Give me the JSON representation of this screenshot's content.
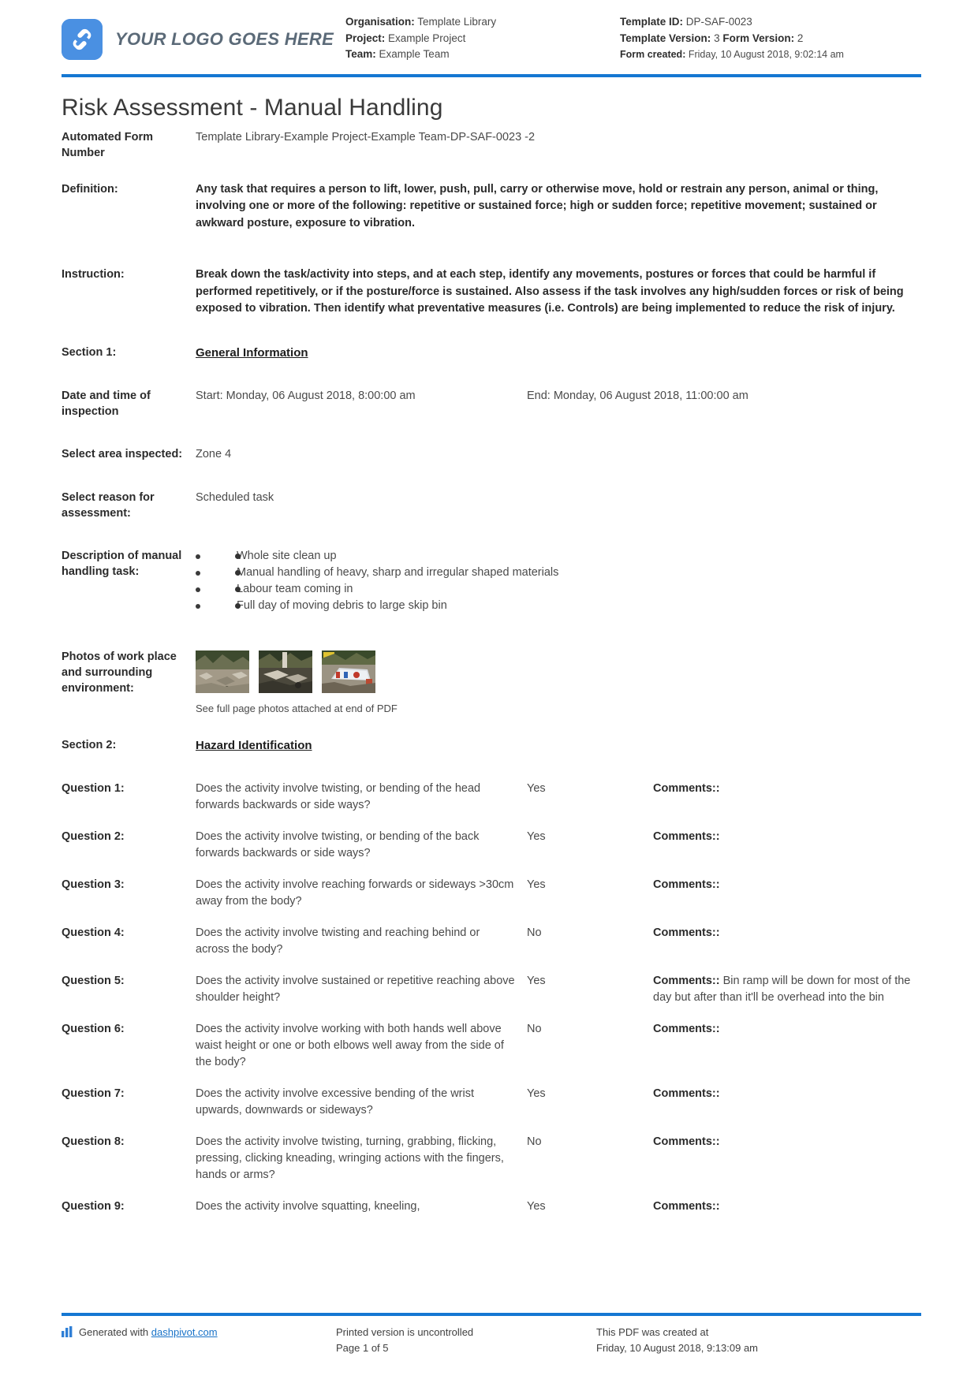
{
  "header": {
    "logo_text": "YOUR LOGO GOES HERE",
    "left_meta": [
      {
        "label": "Organisation:",
        "value": "Template Library"
      },
      {
        "label": "Project:",
        "value": "Example Project"
      },
      {
        "label": "Team:",
        "value": "Example Team"
      }
    ],
    "right_meta": {
      "template_id_label": "Template ID:",
      "template_id_value": "DP-SAF-0023",
      "template_version_label": "Template Version:",
      "template_version_value": "3",
      "form_version_label": "Form Version:",
      "form_version_value": "2",
      "form_created_label": "Form created:",
      "form_created_value": "Friday, 10 August 2018, 9:02:14 am"
    }
  },
  "document": {
    "title": "Risk Assessment - Manual Handling",
    "automated_form_number_label": "Automated Form Number",
    "automated_form_number_value": "Template Library-Example Project-Example Team-DP-SAF-0023   -2",
    "definition_label": "Definition:",
    "definition_value": "Any task that requires a person to lift, lower, push, pull, carry or otherwise move, hold or restrain any person, animal or thing, involving one or more of the following: repetitive or sustained force; high or sudden force; repetitive movement; sustained or awkward posture, exposure to vibration.",
    "instruction_label": "Instruction:",
    "instruction_value": "Break down the task/activity into steps, and at each step, identify any movements, postures or forces that could be harmful if performed repetitively, or if the posture/force is sustained. Also assess if the task involves any high/sudden forces or risk of being exposed to vibration. Then identify what preventative measures (i.e. Controls) are being implemented to reduce the risk of injury."
  },
  "section1": {
    "label": "Section 1:",
    "heading": "General Information",
    "date_time_label": "Date and time of inspection",
    "start_value": "Start: Monday, 06 August 2018, 8:00:00 am",
    "end_value": "End: Monday, 06 August 2018, 11:00:00 am",
    "area_label": "Select area inspected:",
    "area_value": "Zone 4",
    "reason_label": "Select reason for assessment:",
    "reason_value": "Scheduled task",
    "description_label": "Description of manual handling task:",
    "description_items": [
      "Whole site clean up",
      "Manual handling of heavy, sharp and irregular shaped materials",
      "Labour team coming in",
      "Full day of moving debris to large skip bin"
    ],
    "photos_label": "Photos of work place and surrounding environment:",
    "photos_caption": "See full page photos attached at end of PDF",
    "photos_count": 3
  },
  "section2": {
    "label": "Section 2:",
    "heading": "Hazard Identification",
    "comments_label": "Comments::",
    "questions": [
      {
        "label": "Question 1:",
        "text": "Does the activity involve twisting, or bending of the head forwards backwards or side ways?",
        "answer": "Yes",
        "comment": ""
      },
      {
        "label": "Question 2:",
        "text": "Does the activity involve twisting, or bending of the back forwards backwards or side ways?",
        "answer": "Yes",
        "comment": ""
      },
      {
        "label": "Question 3:",
        "text": "Does the activity involve reaching forwards or sideways >30cm away from the body?",
        "answer": "Yes",
        "comment": ""
      },
      {
        "label": "Question 4:",
        "text": "Does the activity involve twisting and reaching behind or across the body?",
        "answer": "No",
        "comment": ""
      },
      {
        "label": "Question 5:",
        "text": "Does the activity involve sustained or repetitive reaching above shoulder height?",
        "answer": "Yes",
        "comment": " Bin ramp will be down for most of the day but after than it'll be overhead into the bin"
      },
      {
        "label": "Question 6:",
        "text": "Does the activity involve working with both hands well above waist height or one or both elbows well away from the side of the body?",
        "answer": "No",
        "comment": ""
      },
      {
        "label": "Question 7:",
        "text": "Does the activity involve excessive bending of the wrist upwards, downwards or sideways?",
        "answer": "Yes",
        "comment": ""
      },
      {
        "label": "Question 8:",
        "text": "Does the activity involve twisting, turning, grabbing, flicking, pressing, clicking kneading, wringing actions with the fingers, hands or arms?",
        "answer": "No",
        "comment": ""
      },
      {
        "label": "Question 9:",
        "text": "Does the activity involve squatting, kneeling,",
        "answer": "Yes",
        "comment": ""
      }
    ]
  },
  "footer": {
    "generated_prefix": "Generated with ",
    "generated_link": "dashpivot.com",
    "printed_line1": "Printed version is uncontrolled",
    "printed_line2": "Page 1 of 5",
    "created_line1": "This PDF was created at",
    "created_line2": "Friday, 10 August 2018, 9:13:09 am"
  },
  "colors": {
    "accent": "#1577d2",
    "logo_blue": "#4a90e2",
    "link": "#1a73c8"
  }
}
